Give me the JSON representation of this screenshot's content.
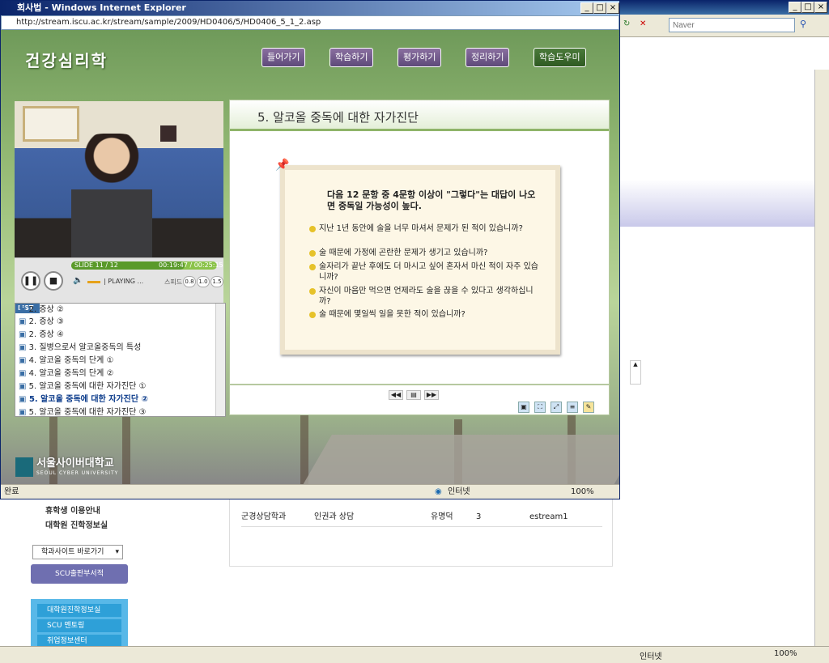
{
  "background_window": {
    "search_placeholder": "Naver",
    "status_zone": "인터넷",
    "status_zoom": "100%",
    "table_rows": [
      {
        "dept": "군경상담학과",
        "course": "인권과 상담",
        "prof": "유명덕",
        "credit": "3",
        "server": "estream1"
      }
    ],
    "left_links": [
      "휴학생 이용안내",
      "대학원 진학정보실"
    ],
    "site_select": "학과사이트 바로가기",
    "scu_button": "SCU출판부서적",
    "quick_links": [
      "대학원진학정보실",
      "SCU 멘토링",
      "취업정보센터"
    ]
  },
  "popup": {
    "title": "회사법 - Windows Internet Explorer",
    "address": "http://stream.iscu.ac.kr/stream/sample/2009/HD0406/5/HD0406_5_1_2.asp",
    "app_title": "건강심리학",
    "nav": [
      "들어가기",
      "학습하기",
      "평가하기",
      "정리하기",
      "학습도우미"
    ],
    "player": {
      "slide": "SLIDE 11 / 12",
      "time": "00:19:47 / 00:25:15",
      "status": "| PLAYING ...",
      "speed_label": "스피드",
      "speeds": [
        "0.8",
        "1.0",
        "1.5"
      ],
      "progress": 0.78
    },
    "list": {
      "header": "LIST",
      "items": [
        "2. 증상 ②",
        "2. 증상 ③",
        "2. 증상 ④",
        "3. 질병으로서 알코올중독의 특성",
        "4. 알코올 중독의 단계 ①",
        "4. 알코올 중독의 단계 ②",
        "5. 알코올 중독에 대한 자가진단 ①",
        "5. 알코올 중독에 대한 자가진단 ②",
        "5. 알코올 중독에 대한 자가진단 ③"
      ],
      "active_index": 7
    },
    "slide": {
      "title": "5. 알코올 중독에 대한 자가진단",
      "heading": "다음 12 문항 중 4문항 이상이 \"그렇다\"는 대답이 나오면 중독일 가능성이 높다.",
      "questions": [
        "지난 1년 동안에 술을 너무 마셔서 문제가 된 적이 있습니까?",
        "술 때문에 가정에 곤란한 문제가 생기고 있습니까?",
        "술자리가 끝난 후에도 더 마시고 싶어 혼자서 마신 적이 자주 있습니까?",
        "자신이 마음만 먹으면 언제라도 술을 끊을 수 있다고 생각하십니까?",
        "술 때문에 몇일씩 일을 못한 적이 있습니까?"
      ]
    },
    "logo": {
      "name": "서울사이버대학교",
      "sub": "SEOUL CYBER UNIVERSITY"
    },
    "status_left": "완료",
    "status_zone": "인터넷",
    "status_zoom": "100%"
  }
}
